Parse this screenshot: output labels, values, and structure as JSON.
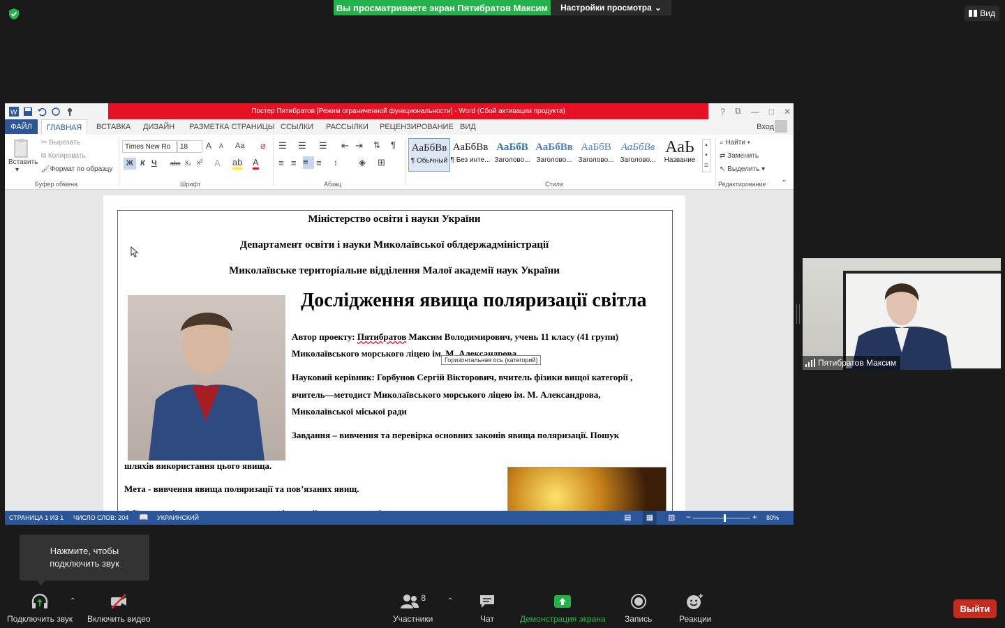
{
  "share": {
    "banner": "Вы просматриваете экран Пятибратов Максим",
    "view_settings": "Настройки просмотра",
    "view_button": "Вид"
  },
  "word": {
    "title": "Постер Пятибратов  [Режим ограниченной функциональности] -  Word (Сбой активации продукта)",
    "window_controls": [
      "?",
      "⧉",
      "—",
      "□",
      "✕"
    ],
    "tabs": [
      "ФАЙЛ",
      "ГЛАВНАЯ",
      "ВСТАВКА",
      "ДИЗАЙН",
      "РАЗМЕТКА СТРАНИЦЫ",
      "ССЫЛКИ",
      "РАССЫЛКИ",
      "РЕЦЕНЗИРОВАНИЕ",
      "ВИД"
    ],
    "signin": "Вход",
    "ribbon": {
      "clipboard": {
        "paste": "Вставить",
        "cut": "Вырезать",
        "copy": "Копировать",
        "format_painter": "Формат по образцу",
        "label": "Буфер обмена"
      },
      "font": {
        "name": "Times New Ro",
        "size": "18",
        "grow": "A",
        "shrink": "A",
        "case": "Aa",
        "bold": "Ж",
        "italic": "К",
        "underline": "Ч",
        "strike": "abc",
        "sub": "x₂",
        "sup": "x²",
        "label": "Шрифт"
      },
      "paragraph": {
        "label": "Абзац"
      },
      "styles": {
        "items": [
          {
            "preview": "АаБбВв",
            "name": "¶ Обычный"
          },
          {
            "preview": "АаБбВв",
            "name": "¶ Без инте..."
          },
          {
            "preview": "АаБбВ",
            "name": "Заголово..."
          },
          {
            "preview": "АаБбВв",
            "name": "Заголово..."
          },
          {
            "preview": "АаБбВ",
            "name": "Заголово..."
          },
          {
            "preview": "АаБбВв",
            "name": "Заголово..."
          },
          {
            "preview": "АаЬ",
            "name": "Название"
          }
        ],
        "label": "Стили"
      },
      "editing": {
        "find": "Найти",
        "replace": "Заменить",
        "select": "Выделить",
        "label": "Редактирование"
      }
    },
    "doc": {
      "line1": "Міністерство освіти і науки України",
      "line2": "Департамент освіти і науки Миколаївської облдержадміністрації",
      "line3": "Миколаївське територіальне відділення Малої академії наук України",
      "title": "Дослідження явища поляризації світла",
      "author_label": "Автор проекту: ",
      "author_name": "Пятибратов",
      "author_rest": " Максим Володимирович, учень 11 класу (41 групи)",
      "author_line2": "Миколаївського морського ліцею ім. М. Александрова",
      "tooltip": "Горизонтальная ось (категорий)",
      "supervisor1": "Науковий керівник: Горбунов Сергій Вікторович, вчитель фізики вищої категорії ,",
      "supervisor2": "вчитель—методист Миколаївського морського ліцею ім. М. Александрова,",
      "supervisor3": "Миколаївської міської ради",
      "task1": "Завдання – вивчення та перевірка основних законів явища поляризації. Пошук",
      "task2": "шляхів використання цього явища.",
      "goal": "Мета - вивчення явища поляризації та пов’язаних явищ.",
      "partial": "Об'єкт дослідження – поляризоване світло та його властивості"
    },
    "status": {
      "page": "СТРАНИЦА 1 ИЗ 1",
      "words": "ЧИСЛО СЛОВ: 204",
      "lang": "УКРАИНСКИЙ",
      "zoom": "80%",
      "zoom_level": 0.55
    }
  },
  "camera": {
    "name": "Пятибратов Максим"
  },
  "toast": {
    "line1": "Нажмите, чтобы",
    "line2": "подключить звук"
  },
  "toolbar": {
    "audio": "Подключить звук",
    "video": "Включить видео",
    "participants": "Участники",
    "participants_count": "8",
    "chat": "Чат",
    "share": "Демонстрация экрана",
    "record": "Запись",
    "reactions": "Реакции",
    "leave": "Выйти"
  },
  "colors": {
    "zoom_green": "#23b34a",
    "word_blue": "#2b579a",
    "title_red": "#e81123",
    "leave_red": "#c42b1c"
  }
}
